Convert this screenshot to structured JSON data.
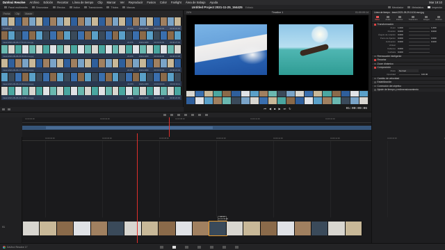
{
  "menubar": {
    "app": "DaVinci Resolve",
    "items": [
      "Archivo",
      "Edición",
      "Recortar",
      "Línea de tiempo",
      "Clip",
      "Marcar",
      "Ver",
      "Reproducir",
      "Fusion",
      "Color",
      "Fairlight",
      "Área de trabajo",
      "Ayuda"
    ],
    "clock": "Mar 19:10"
  },
  "toolbar": {
    "media_pool": "Panel multimedia",
    "sync": "Sincronizar",
    "effects": "Efectos",
    "index": "Índice",
    "transitions": "Transiciones",
    "titles": "Títulos",
    "markers": "Marcas",
    "project_title": "Untitled Project 2021-11-25_164425",
    "project_status": "Editado",
    "mixer": "Mezclador",
    "metadata": "Metadatos",
    "inspector": "Inspector"
  },
  "pool": {
    "header": [
      "Fecha",
      "Clip",
      "Master"
    ],
    "bins": [
      {
        "name": "Timeline 1",
        "fps": "23.976",
        "res": "1920x1080",
        "start": "00:00:00:00",
        "end": "00:00:22:00"
      },
      {
        "name": "travel-2021-09-29-17.51.11.mov.jpg",
        "fps": "23.976",
        "res": "1920x1080",
        "start": "00:00:00:00",
        "end": "00:00:27:01"
      },
      {
        "name": "travel-2021-09-29-15.03.36.mov.jpg",
        "fps": "23.976",
        "res": "1920x1080",
        "start": "00:00:00:00",
        "end": "00:00:13:08"
      },
      {
        "name": "travel-2021-09-29-17.51.03.mov.jpg",
        "fps": "23.976",
        "res": "1920x1080",
        "start": "00:00:00:00",
        "end": "00:00:21:04"
      },
      {
        "name": "travel-2021-09-29-12.03.24.mov.jpg",
        "fps": "23.976",
        "res": "1920x1080",
        "start": "00:00:00:00",
        "end": "00:00:19:11"
      },
      {
        "name": "travel-2021-09-29-16.34.58.mov.jpg",
        "fps": "23.976",
        "res": "1920x1080",
        "start": "00:00:00:00",
        "end": "00:00:24:00"
      }
    ]
  },
  "viewer": {
    "zoom": "24%",
    "timeline_name": "Timeline 1",
    "timecode_top": "01:00:09:14",
    "timecode": "01:00:09:06"
  },
  "inspector": {
    "clip_title": "Línea de tiempo - travel-2021-09-29-16.34.mov.jpg",
    "tabs": [
      "Video",
      "Audio",
      "Efectos",
      "Transición",
      "Imagen",
      "Archivo"
    ],
    "transform_section": "Transformación",
    "props": [
      {
        "k": "Zoom",
        "v": "1.000",
        "v2": "1.000"
      },
      {
        "k": "Posición",
        "v": "0.000",
        "v2": "0.000"
      },
      {
        "k": "Ángulo de rotación",
        "v": "0.000",
        "v2": ""
      },
      {
        "k": "Punto de fijación",
        "v": "0.000",
        "v2": "0.000"
      },
      {
        "k": "Inclinación",
        "v": "0.000",
        "v2": "0.000"
      },
      {
        "k": "Voltear",
        "v": "",
        "v2": ""
      },
      {
        "k": "Cabeceo",
        "v": "0.000",
        "v2": ""
      },
      {
        "k": "Guiñada",
        "v": "0.000",
        "v2": ""
      }
    ],
    "smart_reframe": "Reencuadre inteligente",
    "crop": "Recortar",
    "dynamic_zoom": "Zoom dinámico",
    "composite": "Composición",
    "composite_mode_k": "Modo",
    "composite_mode_v": "Normal",
    "opacity_k": "Opacidad",
    "opacity_v": "100.00",
    "speed": "Cambio de velocidad",
    "stabilization": "Estabilización",
    "lens": "Corrección del objetivo",
    "retime": "Ajuste de tiempo y redimensionamiento"
  },
  "timeline": {
    "ruler_top": [
      "01:00:00:00",
      "01:00:04:00",
      "01:00:08:00",
      "01:00:12:00",
      "01:00:16:00"
    ],
    "ruler_main": [
      "01:00:04:00",
      "01:00:06:00",
      "01:00:08:00",
      "01:00:10:00",
      "01:00:12:00",
      "01:00:14:00",
      "01:00:16:00",
      "01:00:18:00"
    ],
    "track_v1": "V1",
    "track_a1": "A1",
    "tooltip": "+00:10 01:00:09:09"
  },
  "footer": {
    "brand": "DaVinci Resolve 17"
  },
  "colors": {
    "playhead": "#e0302c",
    "accent": "#e44",
    "selected_clip": "#e89a2c"
  }
}
